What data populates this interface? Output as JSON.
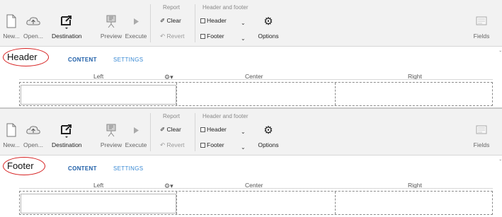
{
  "ribbon": {
    "new_label": "New...",
    "open_label": "Open...",
    "destination_label": "Destination",
    "preview_label": "Preview",
    "execute_label": "Execute",
    "report_group": "Report",
    "clear_label": "Clear",
    "revert_label": "Revert",
    "header_footer_group": "Header and footer",
    "header_checkbox": "Header",
    "footer_checkbox": "Footer",
    "options_label": "Options",
    "fields_label": "Fields"
  },
  "panels": [
    {
      "section_title": "Header",
      "tabs": [
        "CONTENT",
        "SETTINGS"
      ],
      "columns": [
        "Left",
        "Center",
        "Right"
      ]
    },
    {
      "section_title": "Footer",
      "tabs": [
        "CONTENT",
        "SETTINGS"
      ],
      "columns": [
        "Left",
        "Center",
        "Right"
      ]
    }
  ],
  "colors": {
    "accent_tab": "#1f5fa8",
    "annotation_circle": "#d62020"
  }
}
